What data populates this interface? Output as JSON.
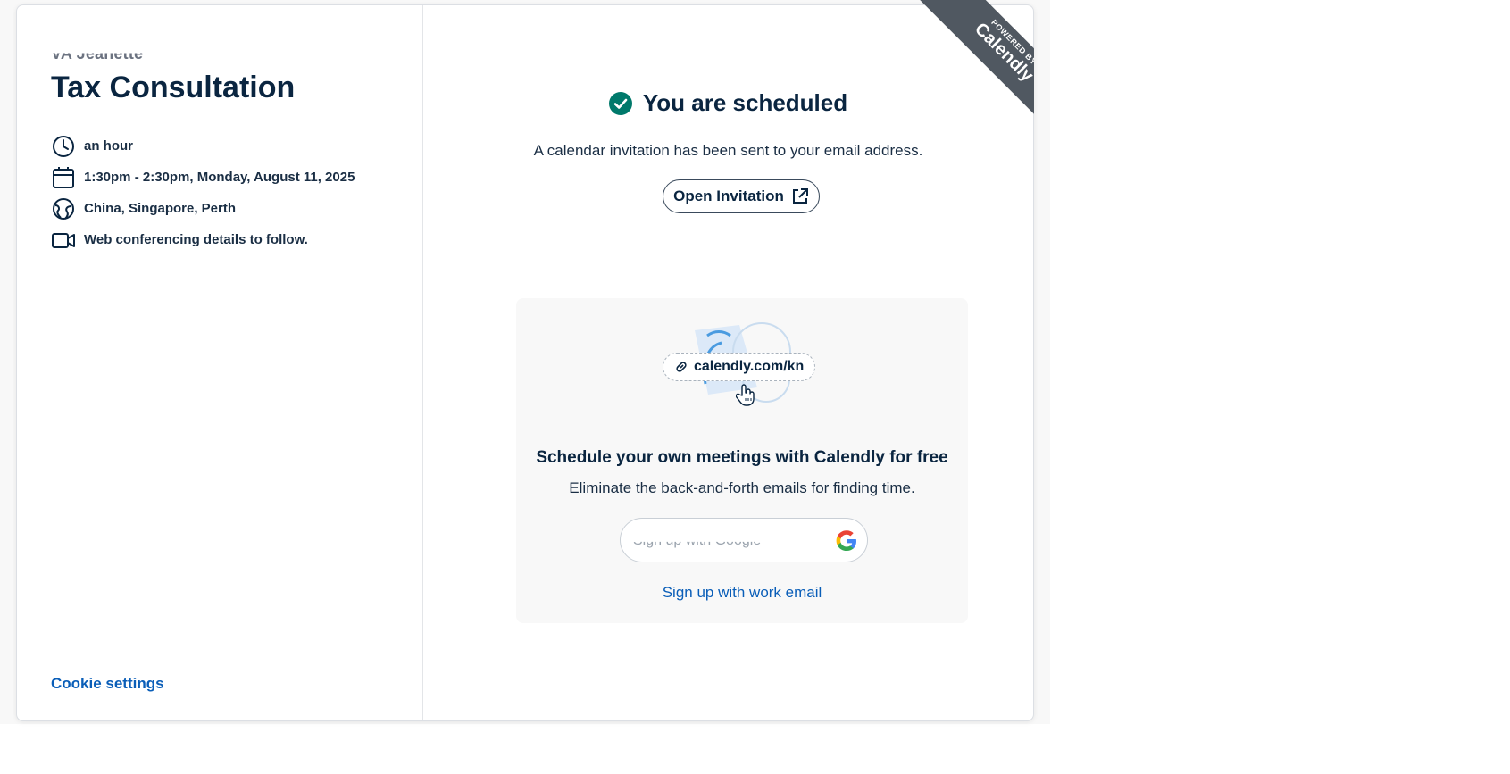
{
  "left_panel": {
    "organizer_name": "VA Jeanette",
    "event_title": "Tax Consultation",
    "details": [
      {
        "icon": "clock-icon",
        "text": "an hour"
      },
      {
        "icon": "calendar-icon",
        "text": "1:30pm - 2:30pm, Monday, August 11, 2025"
      },
      {
        "icon": "globe-icon",
        "text": "China, Singapore, Perth"
      },
      {
        "icon": "video-camera-icon",
        "text": "Web conferencing details to follow."
      }
    ],
    "cookie_settings": "Cookie settings"
  },
  "confirmation": {
    "headline": "You are scheduled",
    "subline": "A calendar invitation has been sent to your email address.",
    "open_invitation": "Open Invitation"
  },
  "promo": {
    "link_text": "calendly.com/kn",
    "title": "Schedule your own meetings with Calendly for free",
    "subtitle": "Eliminate the back-and-forth emails for finding time.",
    "google_button": "Sign up with Google",
    "work_email": "Sign up with work email"
  },
  "ribbon": {
    "small": "POWERED BY",
    "brand": "Calendly"
  },
  "colors": {
    "navy": "#0a2540",
    "link_blue": "#0a5eb8",
    "success_green": "#00796b",
    "ribbon_gray": "#505861"
  }
}
